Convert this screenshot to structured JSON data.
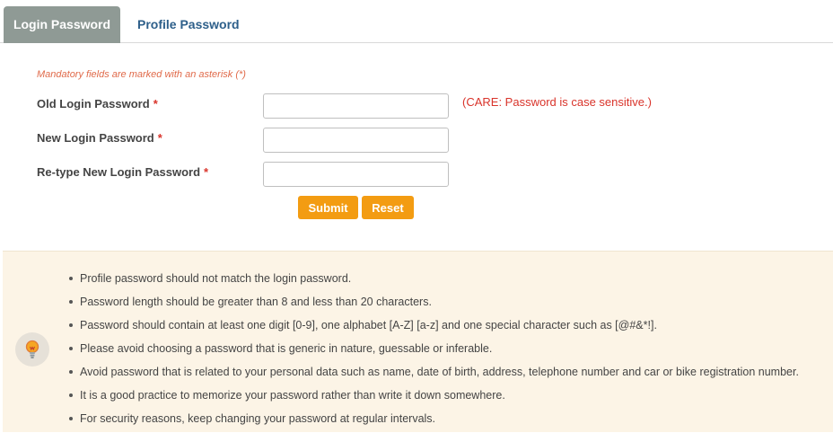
{
  "tabs": {
    "login_password": "Login Password",
    "profile_password": "Profile Password"
  },
  "form": {
    "mandatory_note": "Mandatory fields are marked with an asterisk (*)",
    "old_password_label": "Old Login Password",
    "new_password_label": "New Login Password",
    "retype_password_label": "Re-type New Login Password",
    "asterisk": "*",
    "old_password_value": "",
    "new_password_value": "",
    "retype_password_value": "",
    "care_note": "(CARE: Password is case sensitive.)",
    "submit_label": "Submit",
    "reset_label": "Reset"
  },
  "tips": [
    "Profile password should not match the login password.",
    "Password length should be greater than 8 and less than 20 characters.",
    "Password should contain at least one digit [0-9], one alphabet [A-Z] [a-z] and one special character such as [@#&*!].",
    "Please avoid choosing a password that is generic in nature, guessable or inferable.",
    "Avoid password that is related to your personal data such as name, date of birth, address, telephone number and car or bike registration number.",
    "It is a good practice to memorize your password rather than write it down somewhere.",
    "For security reasons, keep changing your password at regular intervals."
  ],
  "icons": {
    "tips": "lightbulb-icon"
  },
  "colors": {
    "active_tab": "#8f9a95",
    "inactive_tab_text": "#2d5f8a",
    "button": "#f39c12",
    "warning_text": "#d9342b",
    "info_panel_bg": "#fcf4e6"
  }
}
